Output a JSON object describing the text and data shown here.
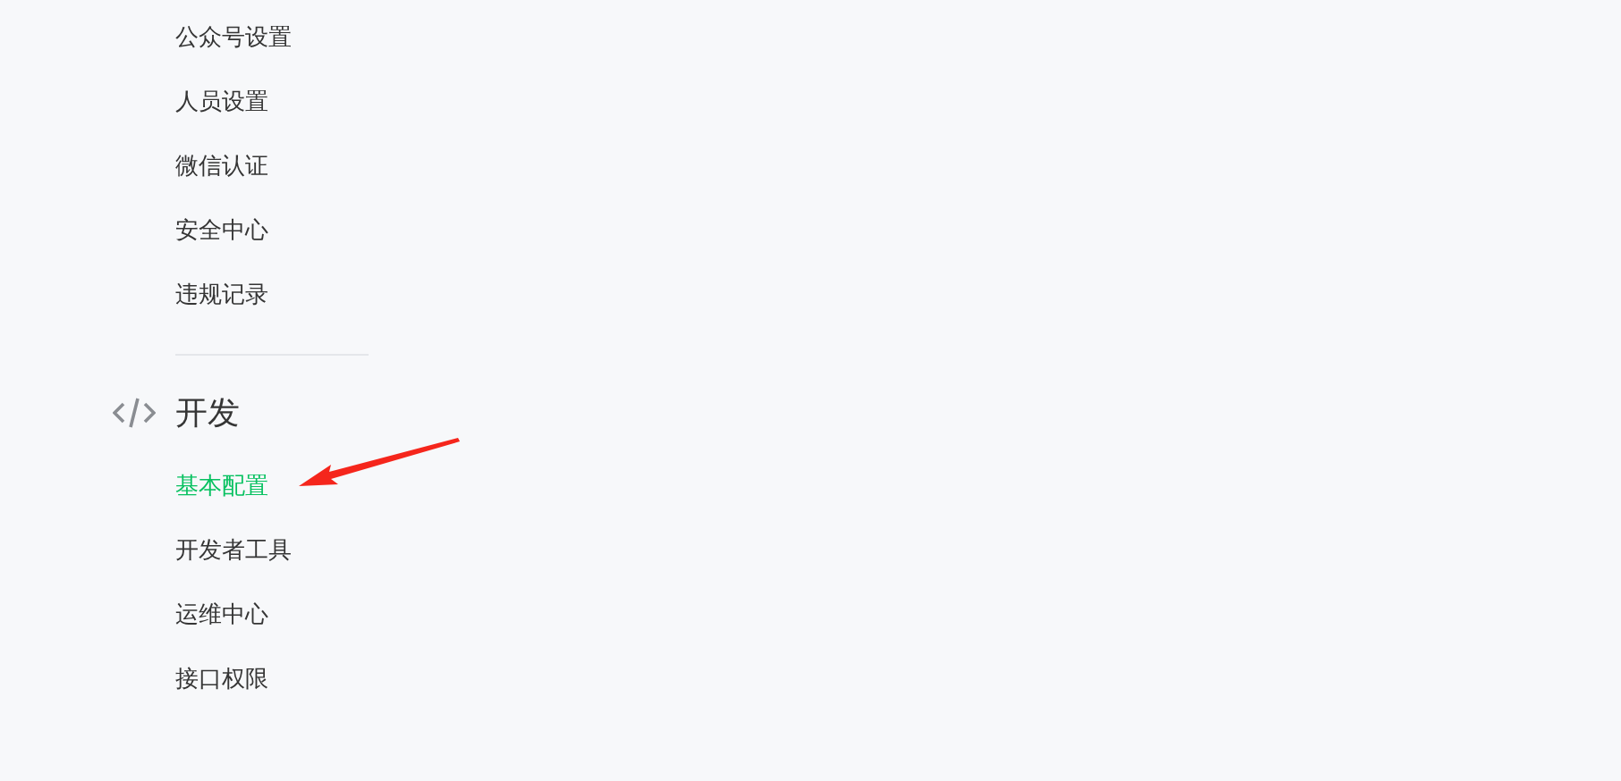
{
  "sections": [
    {
      "items": [
        {
          "label": "公众号设置",
          "selected": false
        },
        {
          "label": "人员设置",
          "selected": false
        },
        {
          "label": "微信认证",
          "selected": false
        },
        {
          "label": "安全中心",
          "selected": false
        },
        {
          "label": "违规记录",
          "selected": false
        }
      ]
    },
    {
      "title": "开发",
      "items": [
        {
          "label": "基本配置",
          "selected": true
        },
        {
          "label": "开发者工具",
          "selected": false
        },
        {
          "label": "运维中心",
          "selected": false
        },
        {
          "label": "接口权限",
          "selected": false
        }
      ]
    }
  ]
}
